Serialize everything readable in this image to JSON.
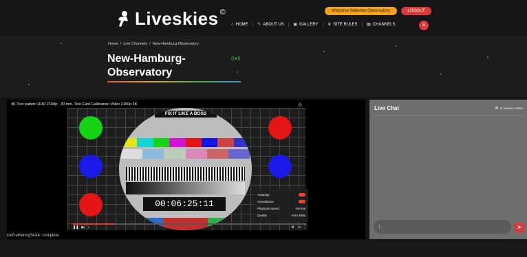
{
  "brand": {
    "name": "Liveskies",
    "registered": "©"
  },
  "user": {
    "welcome": "Welcome Waterloo Observatory",
    "logout": "LOGOUT"
  },
  "nav": {
    "items": [
      {
        "label": "HOME",
        "icon": "home-icon"
      },
      {
        "label": "ABOUT US",
        "icon": "info-icon"
      },
      {
        "label": "GALLERY",
        "icon": "gallery-icon"
      },
      {
        "label": "SITE RULES",
        "icon": "rules-icon"
      },
      {
        "label": "CHANNELS",
        "icon": "channels-icon"
      }
    ]
  },
  "breadcrumb": [
    "Home",
    "/",
    "Live Channels",
    "/",
    "New-Hamburg-Observatory"
  ],
  "page": {
    "title": "New-Hamburg-Observatory",
    "title_line1": "New-Hamburg-",
    "title_line2": "Observatory"
  },
  "player": {
    "video_title": "4K Test pattern UHD 2160p - 30 min. Test Card Calibration Video 2160p 4K",
    "overlay_label": "FIX IT LIKE A BOSS",
    "timecode": "00:06:25:11",
    "menu": [
      {
        "label": "Autoplay",
        "value": ""
      },
      {
        "label": "Annotations",
        "value": ""
      },
      {
        "label": "Playback speed",
        "value": "Normal"
      },
      {
        "label": "Quality",
        "value": "Auto 480p"
      }
    ],
    "progress_fraction": 0.18
  },
  "status": "iceGatheringState: complete",
  "chat": {
    "title": "Live Chat",
    "viewers_label": "is viewers online",
    "input_value": "|"
  },
  "colors": {
    "accent": "#d93a3a",
    "welcome": "#f0a21a",
    "chat_bg": "#6e6e6e"
  }
}
